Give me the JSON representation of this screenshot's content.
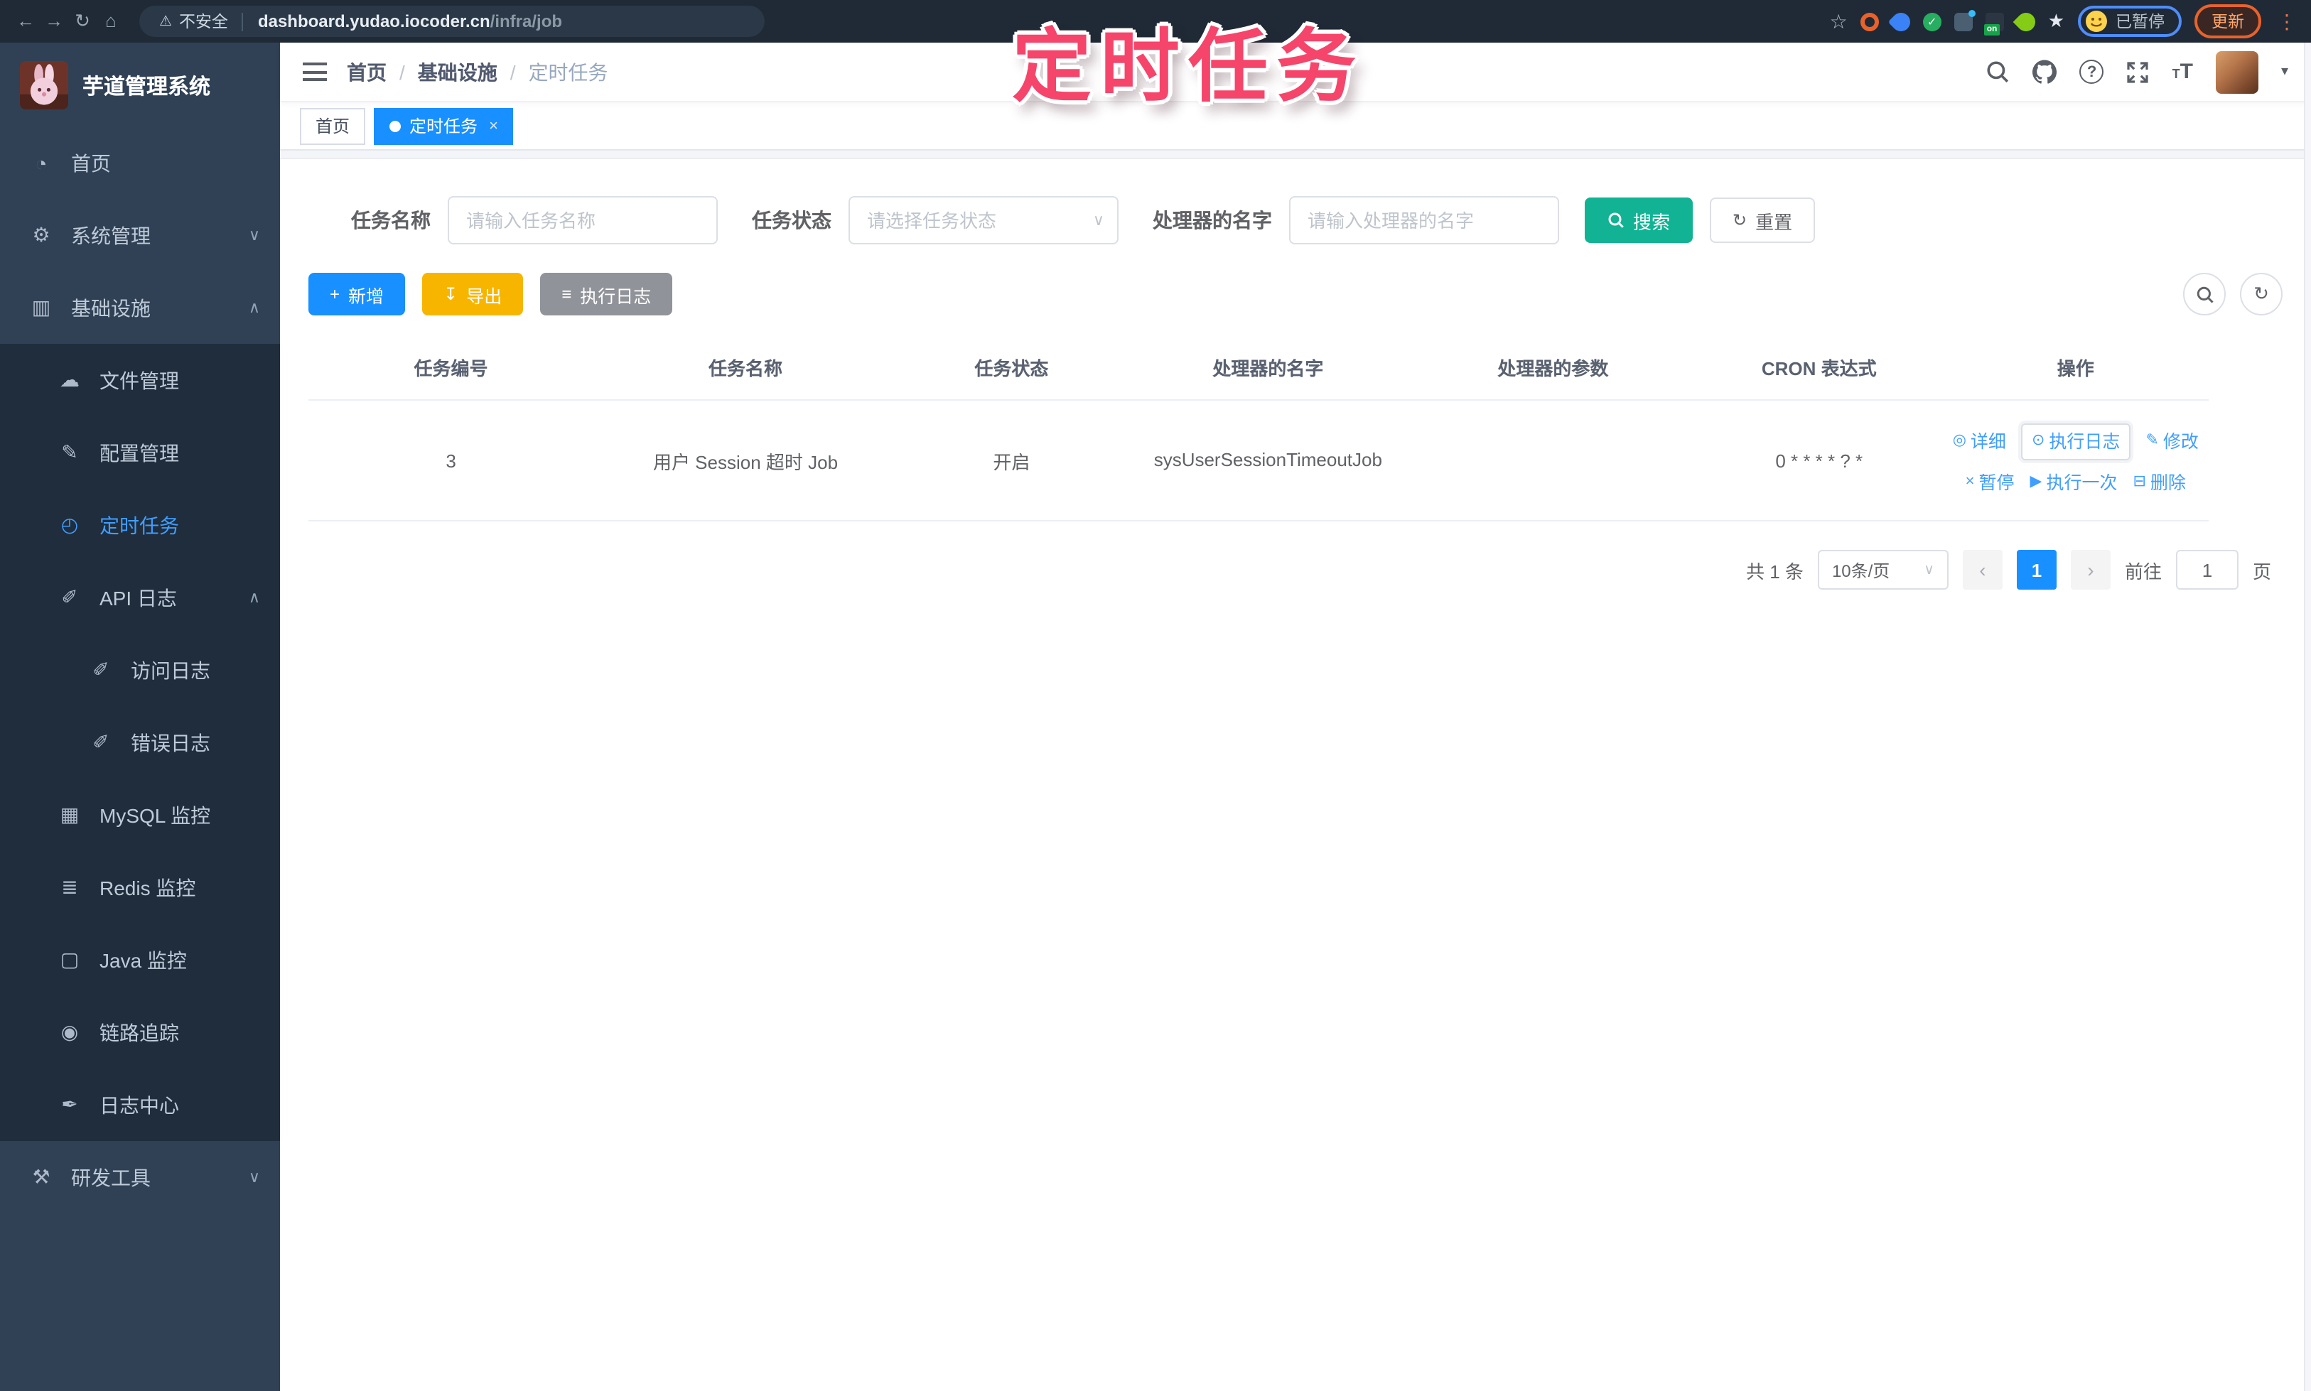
{
  "browser": {
    "security_label": "不安全",
    "url_host": "dashboard.yudao.iocoder.cn",
    "url_path": "/infra/job",
    "ext_on_badge": "on",
    "profile_badge": "已暂停",
    "update_label": "更新"
  },
  "annotation": {
    "text": "定时任务",
    "color": "#f5456b"
  },
  "sidebar": {
    "title": "芋道管理系统",
    "items": [
      {
        "label": "首页",
        "icon": "dashboard-icon",
        "level": 0
      },
      {
        "label": "系统管理",
        "icon": "gear-icon",
        "level": 0,
        "chevron": "down"
      },
      {
        "label": "基础设施",
        "icon": "infrastructure-icon",
        "level": 0,
        "chevron": "up",
        "expanded": true
      },
      {
        "label": "文件管理",
        "icon": "file-manage-icon",
        "level": 1
      },
      {
        "label": "配置管理",
        "icon": "config-icon",
        "level": 1
      },
      {
        "label": "定时任务",
        "icon": "job-icon",
        "level": 1,
        "active": true
      },
      {
        "label": "API 日志",
        "icon": "api-log-icon",
        "level": 1,
        "chevron": "up",
        "expanded": true
      },
      {
        "label": "访问日志",
        "icon": "access-log-icon",
        "level": 2
      },
      {
        "label": "错误日志",
        "icon": "error-log-icon",
        "level": 2
      },
      {
        "label": "MySQL 监控",
        "icon": "mysql-icon",
        "level": 1
      },
      {
        "label": "Redis 监控",
        "icon": "redis-icon",
        "level": 1
      },
      {
        "label": "Java 监控",
        "icon": "java-icon",
        "level": 1
      },
      {
        "label": "链路追踪",
        "icon": "trace-icon",
        "level": 1
      },
      {
        "label": "日志中心",
        "icon": "log-center-icon",
        "level": 1
      },
      {
        "label": "研发工具",
        "icon": "devtools-icon",
        "level": 0,
        "chevron": "down"
      }
    ]
  },
  "breadcrumb": {
    "items": [
      "首页",
      "基础设施",
      "定时任务"
    ],
    "separator": "/"
  },
  "tabs": [
    {
      "label": "首页",
      "active": false
    },
    {
      "label": "定时任务",
      "active": true,
      "close": "×"
    }
  ],
  "filters": {
    "name_label": "任务名称",
    "name_placeholder": "请输入任务名称",
    "status_label": "任务状态",
    "status_placeholder": "请选择任务状态",
    "handler_label": "处理器的名字",
    "handler_placeholder": "请输入处理器的名字",
    "search_label": "搜索",
    "reset_label": "重置"
  },
  "toolbar": {
    "add_label": "新增",
    "export_label": "导出",
    "exec_log_label": "执行日志"
  },
  "table": {
    "columns": [
      "任务编号",
      "任务名称",
      "任务状态",
      "处理器的名字",
      "处理器的参数",
      "CRON 表达式",
      "操作"
    ],
    "rows": [
      {
        "id": "3",
        "name": "用户 Session 超时 Job",
        "status": "开启",
        "handler": "sysUserSessionTimeoutJob",
        "param": "",
        "cron": "0 * * * * ? *"
      }
    ],
    "actions": [
      {
        "label": "详细"
      },
      {
        "label": "执行日志"
      },
      {
        "label": "修改"
      },
      {
        "label": "暂停"
      },
      {
        "label": "执行一次"
      },
      {
        "label": "删除"
      }
    ]
  },
  "pagination": {
    "total": "共 1 条",
    "page_size": "10条/页",
    "prev": "‹",
    "current": "1",
    "next": "›",
    "goto_label": "前往",
    "goto_value": "1",
    "page_unit": "页"
  }
}
